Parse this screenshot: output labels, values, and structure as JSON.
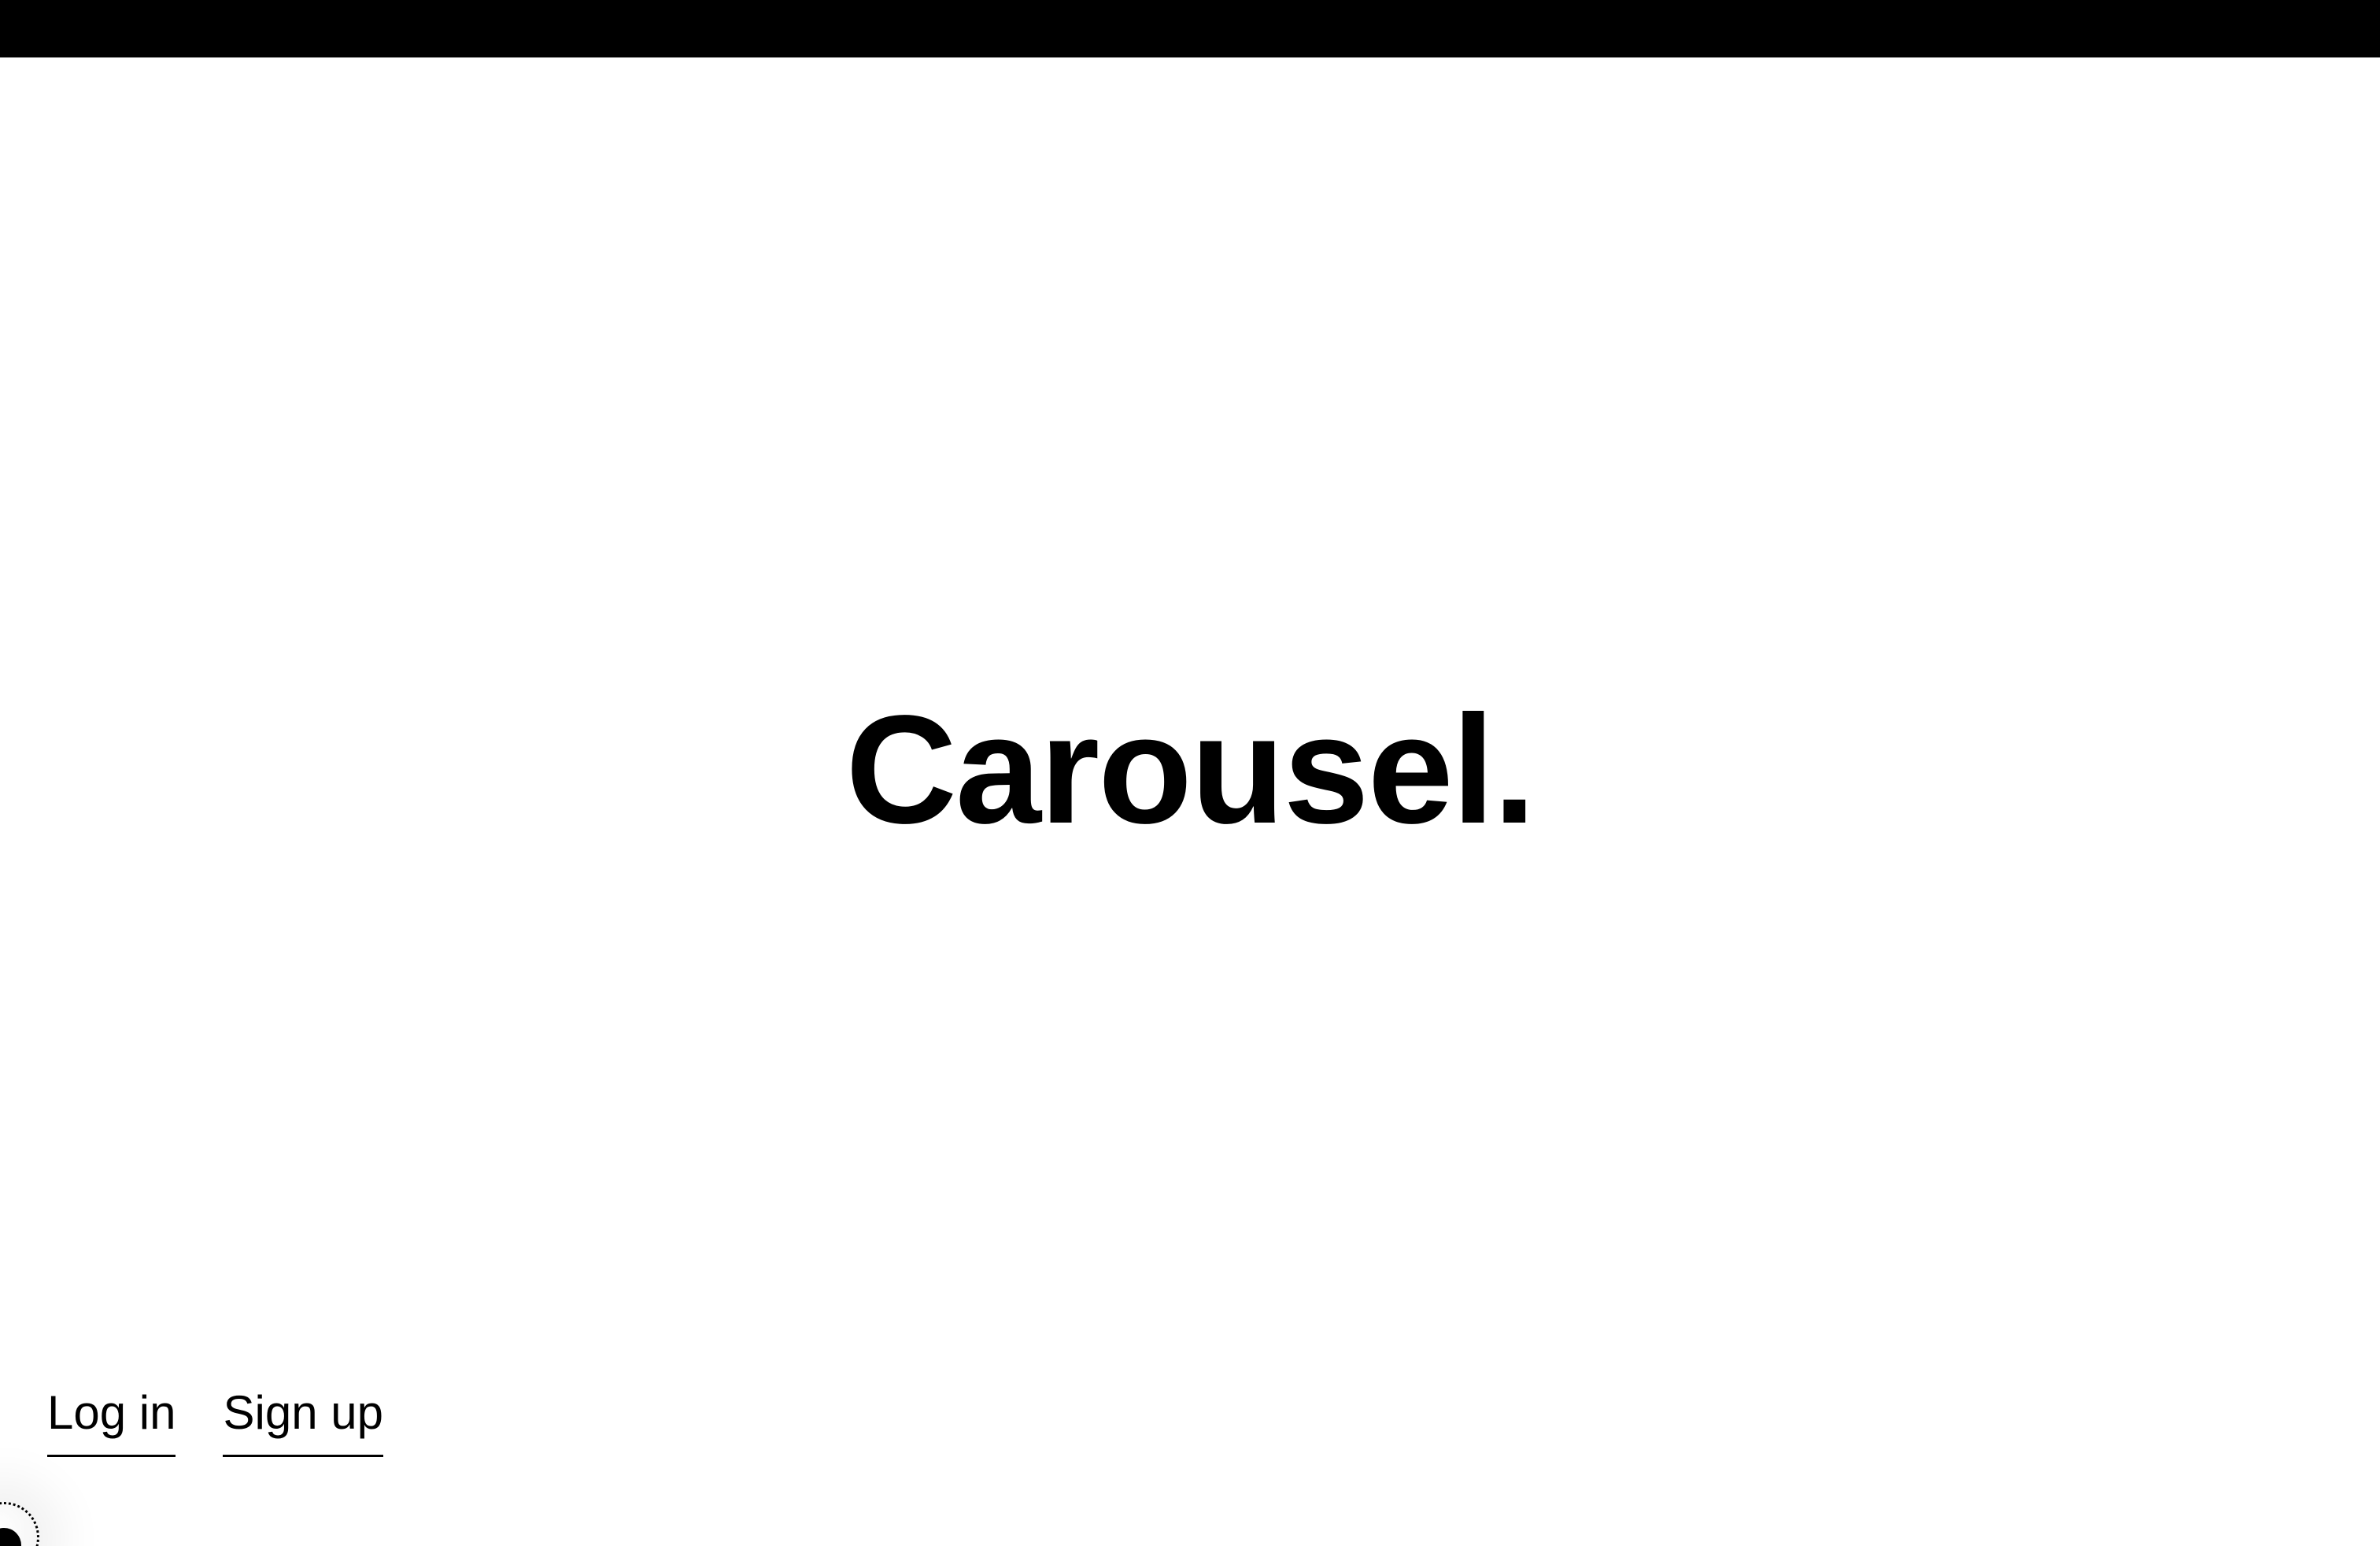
{
  "header": {
    "bar_color": "#000000"
  },
  "hero": {
    "title": "Carousel."
  },
  "auth": {
    "login_label": "Log in",
    "signup_label": "Sign up"
  },
  "widget": {
    "icon": "avatar-icon"
  },
  "colors": {
    "background": "#ffffff",
    "text": "#000000"
  }
}
